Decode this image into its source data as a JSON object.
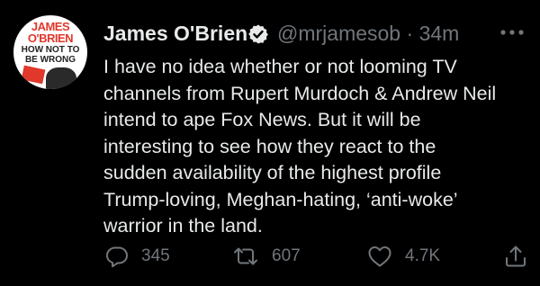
{
  "tweet": {
    "author_name": "James O'Brien",
    "handle": "@mrjamesob",
    "time": "34m",
    "separator": " · ",
    "text": "I have no idea whether or not looming TV\nchannels from Rupert Murdoch & Andrew Neil\nintend to ape Fox News. But it will be\ninteresting to see how they react to the\nsudden availability of the highest profile\nTrump-loving, Meghan-hating, ‘anti-woke’\nwarrior in the land.",
    "avatar_text": [
      "JAMES",
      "O'BRIEN",
      "HOW NOT TO",
      "BE WRONG"
    ],
    "verified": true,
    "icons": {
      "more": "more-dots-icon",
      "verified": "verified-badge-icon",
      "reply": "reply-bubble-icon",
      "retweet": "retweet-arrows-icon",
      "like": "heart-outline-icon",
      "share": "share-up-arrow-icon"
    }
  },
  "actions": {
    "reply_count": "345",
    "retweet_count": "607",
    "like_count": "4.7K"
  },
  "colors": {
    "background": "#000000",
    "primary_text": "#e7e9ea",
    "secondary_text": "#71767b",
    "verified_badge": "#e7e9ea",
    "avatar_red": "#e0382b"
  }
}
